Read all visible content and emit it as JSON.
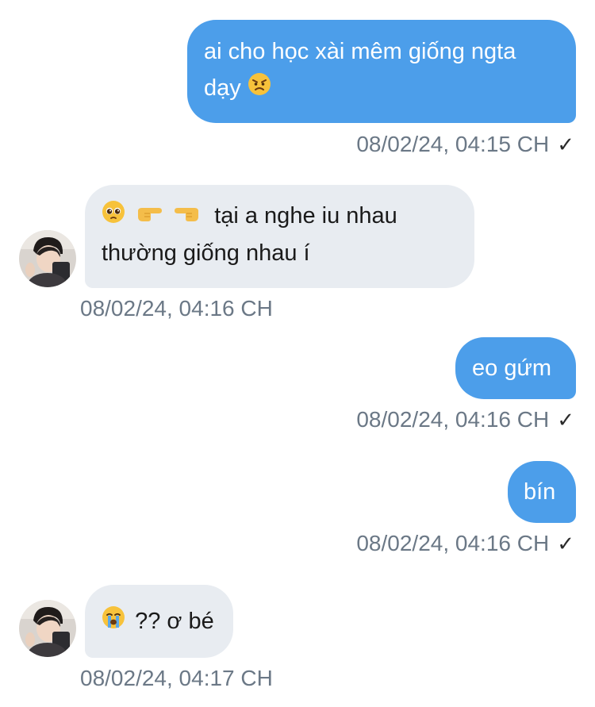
{
  "messages": [
    {
      "direction": "outgoing",
      "line1": "ai cho học xài mêm giống ngta",
      "line2": "dạy",
      "emoji": "angry-face-emoji",
      "timestamp": "08/02/24, 04:15 CH",
      "status": "✓"
    },
    {
      "direction": "incoming",
      "emoji_prefix": [
        "pleading-face-emoji",
        "pointing-right-emoji",
        "pointing-left-emoji"
      ],
      "line1": "tại a nghe iu nhau",
      "line2": "thường giống nhau í",
      "timestamp": "08/02/24, 04:16 CH"
    },
    {
      "direction": "outgoing",
      "text": "eo gứm",
      "timestamp": "08/02/24, 04:16 CH",
      "status": "✓"
    },
    {
      "direction": "outgoing",
      "text": "bín",
      "timestamp": "08/02/24, 04:16 CH",
      "status": "✓"
    },
    {
      "direction": "incoming",
      "emoji": "loudly-crying-face-emoji",
      "text": "?? ơ bé",
      "timestamp": "08/02/24, 04:17 CH"
    }
  ],
  "colors": {
    "outgoing_bubble": "#4c9eea",
    "incoming_bubble": "#e8ecf1",
    "timestamp": "#6b7886"
  }
}
